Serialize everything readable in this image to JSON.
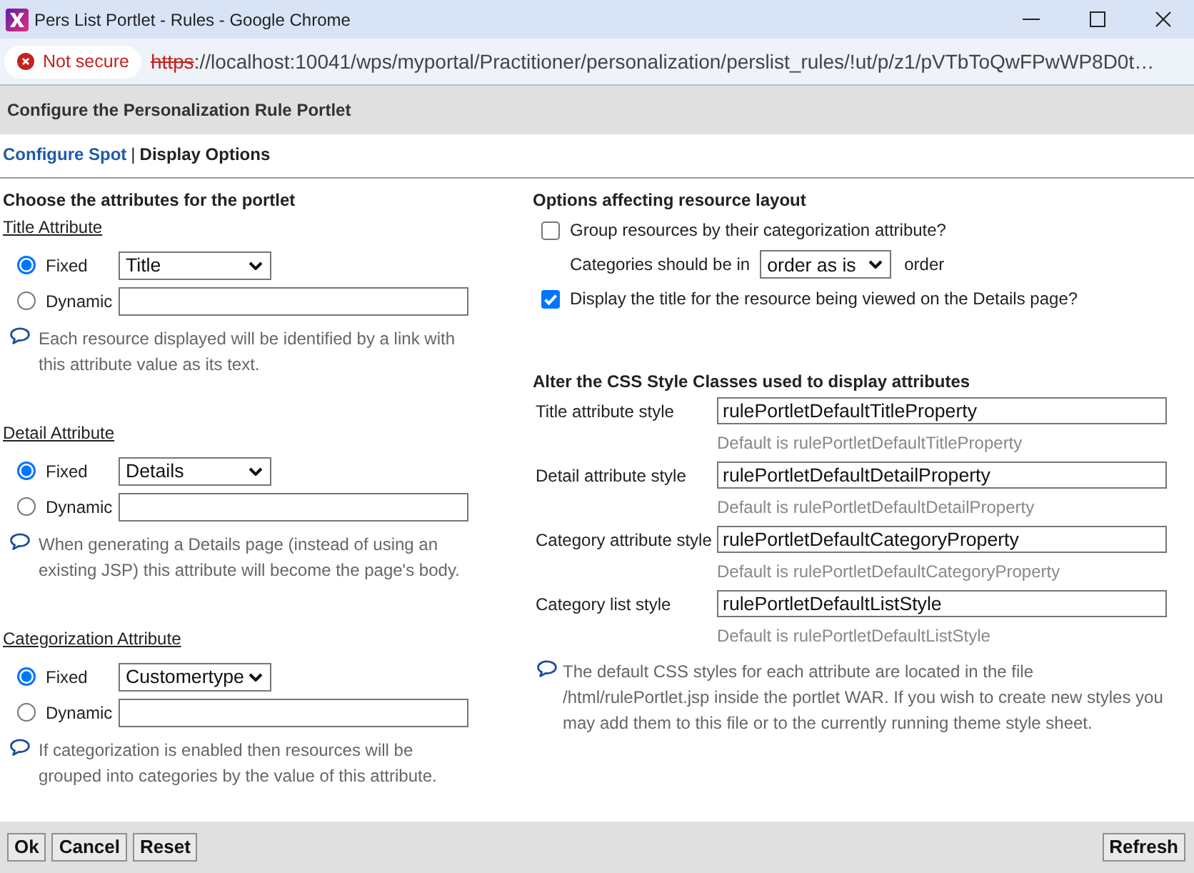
{
  "window": {
    "title": "Pers List Portlet - Rules - Google Chrome"
  },
  "address_bar": {
    "security": "Not secure",
    "url_scheme": "https",
    "url_rest": "://localhost:10041/wps/myportal/Practitioner/personalization/perslist_rules/!ut/p/z1/pVTbToQwFPwWP8D0t…"
  },
  "portlet": {
    "title": "Configure the Personalization Rule Portlet"
  },
  "nav": {
    "items": [
      {
        "label": "Configure Spot",
        "selected": false
      },
      {
        "label": "Display Options",
        "selected": true
      }
    ],
    "separator": "|"
  },
  "attributes": {
    "heading": "Choose the attributes for the portlet",
    "groups": [
      {
        "title": "Title Attribute",
        "options": [
          {
            "kind": "select",
            "label": "Fixed",
            "selected": true,
            "value": "Title"
          },
          {
            "kind": "text",
            "label": "Dynamic",
            "selected": false
          }
        ],
        "help": "Each resource displayed will be identified by a link with this attribute value as its text."
      },
      {
        "title": "Detail Attribute",
        "options": [
          {
            "kind": "select",
            "label": "Fixed",
            "selected": true,
            "value": "Details"
          },
          {
            "kind": "text",
            "label": "Dynamic",
            "selected": false
          }
        ],
        "help": "When generating a Details page (instead of using an existing JSP) this attribute will become the page's body."
      },
      {
        "title": "Categorization Attribute",
        "options": [
          {
            "kind": "select",
            "label": "Fixed",
            "selected": true,
            "value": "Customertype"
          },
          {
            "kind": "text",
            "label": "Dynamic",
            "selected": false
          }
        ],
        "help": "If categorization is enabled then resources will be grouped into categories by the value of this attribute."
      }
    ]
  },
  "layout_options": {
    "heading": "Options affecting resource layout",
    "items": [
      {
        "kind": "checkbox",
        "label": "Group resources by their categorization attribute?",
        "checked": false
      },
      {
        "kind": "select",
        "label": "Categories should be in",
        "value": "order as is",
        "suffix": "order"
      },
      {
        "kind": "checkbox",
        "label": "Display the title for the resource being viewed on the Details page?",
        "checked": true
      }
    ]
  },
  "css_styles": {
    "heading": "Alter the CSS Style Classes used to display attributes",
    "rows": [
      {
        "label": "Title attribute style",
        "value": "rulePortletDefaultTitleProperty",
        "hint": "Default is rulePortletDefaultTitleProperty"
      },
      {
        "label": "Detail attribute style",
        "value": "rulePortletDefaultDetailProperty",
        "hint": "Default is rulePortletDefaultDetailProperty"
      },
      {
        "label": "Category attribute style",
        "value": "rulePortletDefaultCategoryProperty",
        "hint": "Default is rulePortletDefaultCategoryProperty"
      },
      {
        "label": "Category list style",
        "value": "rulePortletDefaultListStyle",
        "hint": "Default is rulePortletDefaultListStyle"
      }
    ],
    "help": "The default CSS styles for each attribute are located in the file /html/rulePortlet.jsp inside the portlet WAR. If you wish to create new styles you may add them to this file or to the currently running theme style sheet."
  },
  "footer": {
    "left_buttons": [
      "Ok",
      "Cancel",
      "Reset"
    ],
    "right_buttons": [
      "Refresh"
    ]
  }
}
